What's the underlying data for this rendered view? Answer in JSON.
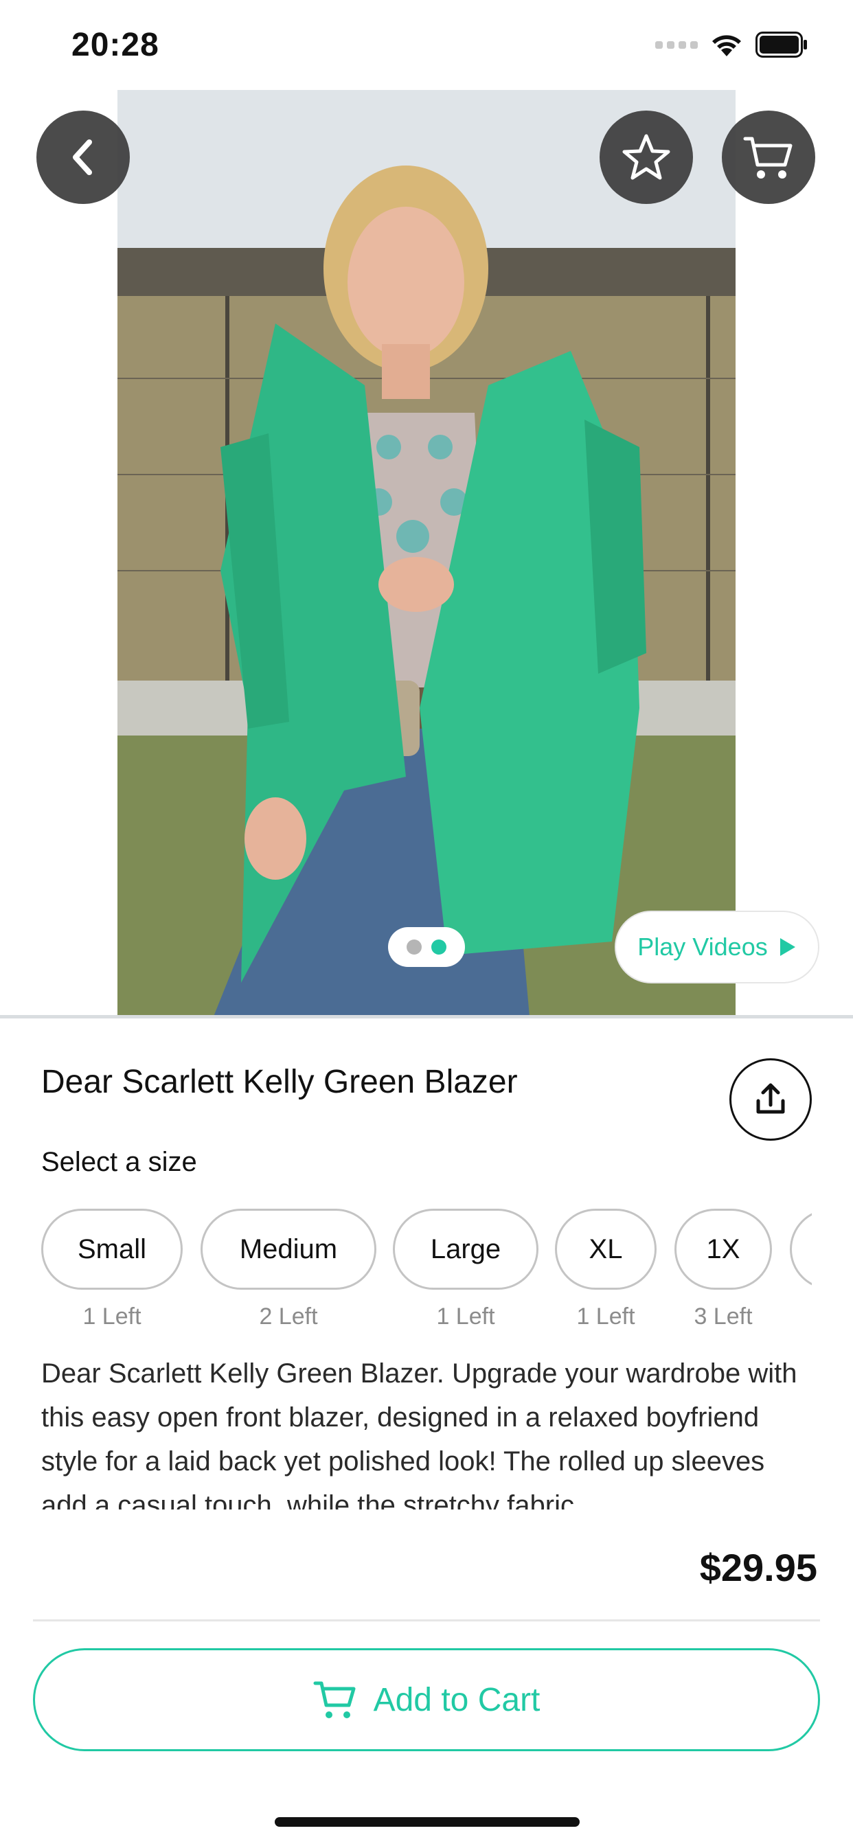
{
  "status_bar": {
    "time": "20:28"
  },
  "hero": {
    "page_indicator": {
      "count": 2,
      "active_index": 1,
      "active_color": "#21c9a4",
      "inactive_color": "#b5b5b5"
    },
    "play_videos_label": "Play Videos"
  },
  "product": {
    "title": "Dear Scarlett Kelly Green Blazer",
    "select_size_label": "Select a size",
    "sizes": [
      {
        "label": "Small",
        "stock": "1 Left"
      },
      {
        "label": "Medium",
        "stock": "2 Left"
      },
      {
        "label": "Large",
        "stock": "1 Left"
      },
      {
        "label": "XL",
        "stock": "1 Left"
      },
      {
        "label": "1X",
        "stock": "3 Left"
      }
    ],
    "description": "Dear Scarlett Kelly Green Blazer. Upgrade your wardrobe with this easy open front blazer, designed in a relaxed boyfriend style for a laid back yet polished look! The rolled up sleeves add a casual touch, while the stretchy fabric"
  },
  "footer": {
    "price": "$29.95",
    "add_to_cart_label": "Add to Cart"
  },
  "colors": {
    "accent": "#21c9a4",
    "button_bg": "#3c3c3c"
  },
  "icons": [
    "back-chevron-icon",
    "star-icon",
    "cart-icon",
    "play-icon",
    "share-icon",
    "add-cart-icon"
  ]
}
